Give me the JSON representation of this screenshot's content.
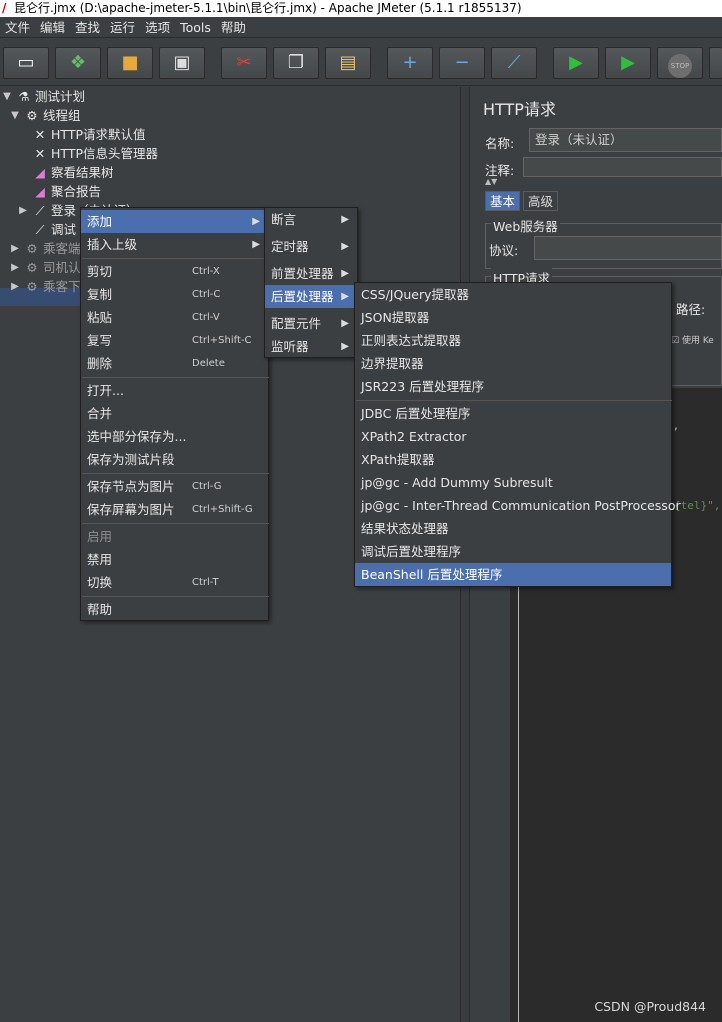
{
  "window": {
    "title": "昆仑行.jmx (D:\\apache-jmeter-5.1.1\\bin\\昆仑行.jmx) - Apache JMeter (5.1.1 r1855137)"
  },
  "menubar": [
    "文件",
    "编辑",
    "查找",
    "运行",
    "选项",
    "Tools",
    "帮助"
  ],
  "toolbar": [
    {
      "name": "new-icon",
      "glyph": "▭"
    },
    {
      "name": "templates-icon",
      "glyph": "❖"
    },
    {
      "name": "open-icon",
      "glyph": "🔒"
    },
    {
      "name": "save-icon",
      "glyph": "▣"
    },
    {
      "name": "cut-icon",
      "glyph": "✂"
    },
    {
      "name": "copy-icon",
      "glyph": "❐"
    },
    {
      "name": "paste-icon",
      "glyph": "📋"
    },
    {
      "name": "expand-icon",
      "glyph": "+"
    },
    {
      "name": "collapse-icon",
      "glyph": "−"
    },
    {
      "name": "toggle-icon",
      "glyph": "⟋"
    },
    {
      "name": "start-icon",
      "glyph": "▶"
    },
    {
      "name": "start-no-pause-icon",
      "glyph": "▶"
    },
    {
      "name": "stop-icon",
      "glyph": "STOP"
    }
  ],
  "tree": {
    "test_plan": "测试计划",
    "thread_group": "线程组",
    "http_defaults": "HTTP请求默认值",
    "header_manager": "HTTP信息头管理器",
    "result_tree": "察看结果树",
    "aggregate_report": "聚合报告",
    "login": "登录（未认证）",
    "debug": "调试",
    "group1": "乘客端",
    "group2": "司机认",
    "group3": "乘客下"
  },
  "context_menu": {
    "items": [
      {
        "label": "添加",
        "arrow": true,
        "highlighted": true
      },
      {
        "label": "插入上级",
        "arrow": true
      },
      {
        "label": "剪切",
        "shortcut": "Ctrl-X"
      },
      {
        "label": "复制",
        "shortcut": "Ctrl-C"
      },
      {
        "label": "粘贴",
        "shortcut": "Ctrl-V"
      },
      {
        "label": "复写",
        "shortcut": "Ctrl+Shift-C"
      },
      {
        "label": "删除",
        "shortcut": "Delete"
      },
      {
        "label": "打开..."
      },
      {
        "label": "合并"
      },
      {
        "label": "选中部分保存为..."
      },
      {
        "label": "保存为测试片段"
      },
      {
        "label": "保存节点为图片",
        "shortcut": "Ctrl-G"
      },
      {
        "label": "保存屏幕为图片",
        "shortcut": "Ctrl+Shift-G"
      },
      {
        "label": "启用",
        "disabled": true
      },
      {
        "label": "禁用"
      },
      {
        "label": "切换",
        "shortcut": "Ctrl-T"
      },
      {
        "label": "帮助"
      }
    ]
  },
  "add_submenu": [
    "断言",
    "定时器",
    "前置处理器",
    "后置处理器",
    "配置元件",
    "监听器"
  ],
  "post_processors": [
    "CSS/JQuery提取器",
    "JSON提取器",
    "正则表达式提取器",
    "边界提取器",
    "JSR223 后置处理程序",
    "JDBC 后置处理程序",
    "XPath2 Extractor",
    "XPath提取器",
    "jp@gc - Add Dummy Subresult",
    "jp@gc - Inter-Thread Communication PostProcessor",
    "结果状态处理器",
    "调试后置处理程序",
    "BeanShell 后置处理程序"
  ],
  "http_panel": {
    "title": "HTTP请求",
    "name_label": "名称:",
    "name_value": "登录（未认证）",
    "comment_label": "注释:",
    "tab_basic": "基本",
    "tab_advanced": "高级",
    "web_server": "Web服务器",
    "protocol_label": "协议:",
    "http_request": "HTTP请求",
    "path_label": "路径:",
    "use_keepalive": "使用 Ke"
  },
  "editor": {
    "snippet1": ",",
    "snippet2": "{tel}\","
  },
  "watermark": "CSDN @Proud844",
  "colors": {
    "background": "#3c3f41",
    "highlight": "#4b6eaf",
    "selection": "#2f65ca",
    "code_green": "#6a8759"
  }
}
